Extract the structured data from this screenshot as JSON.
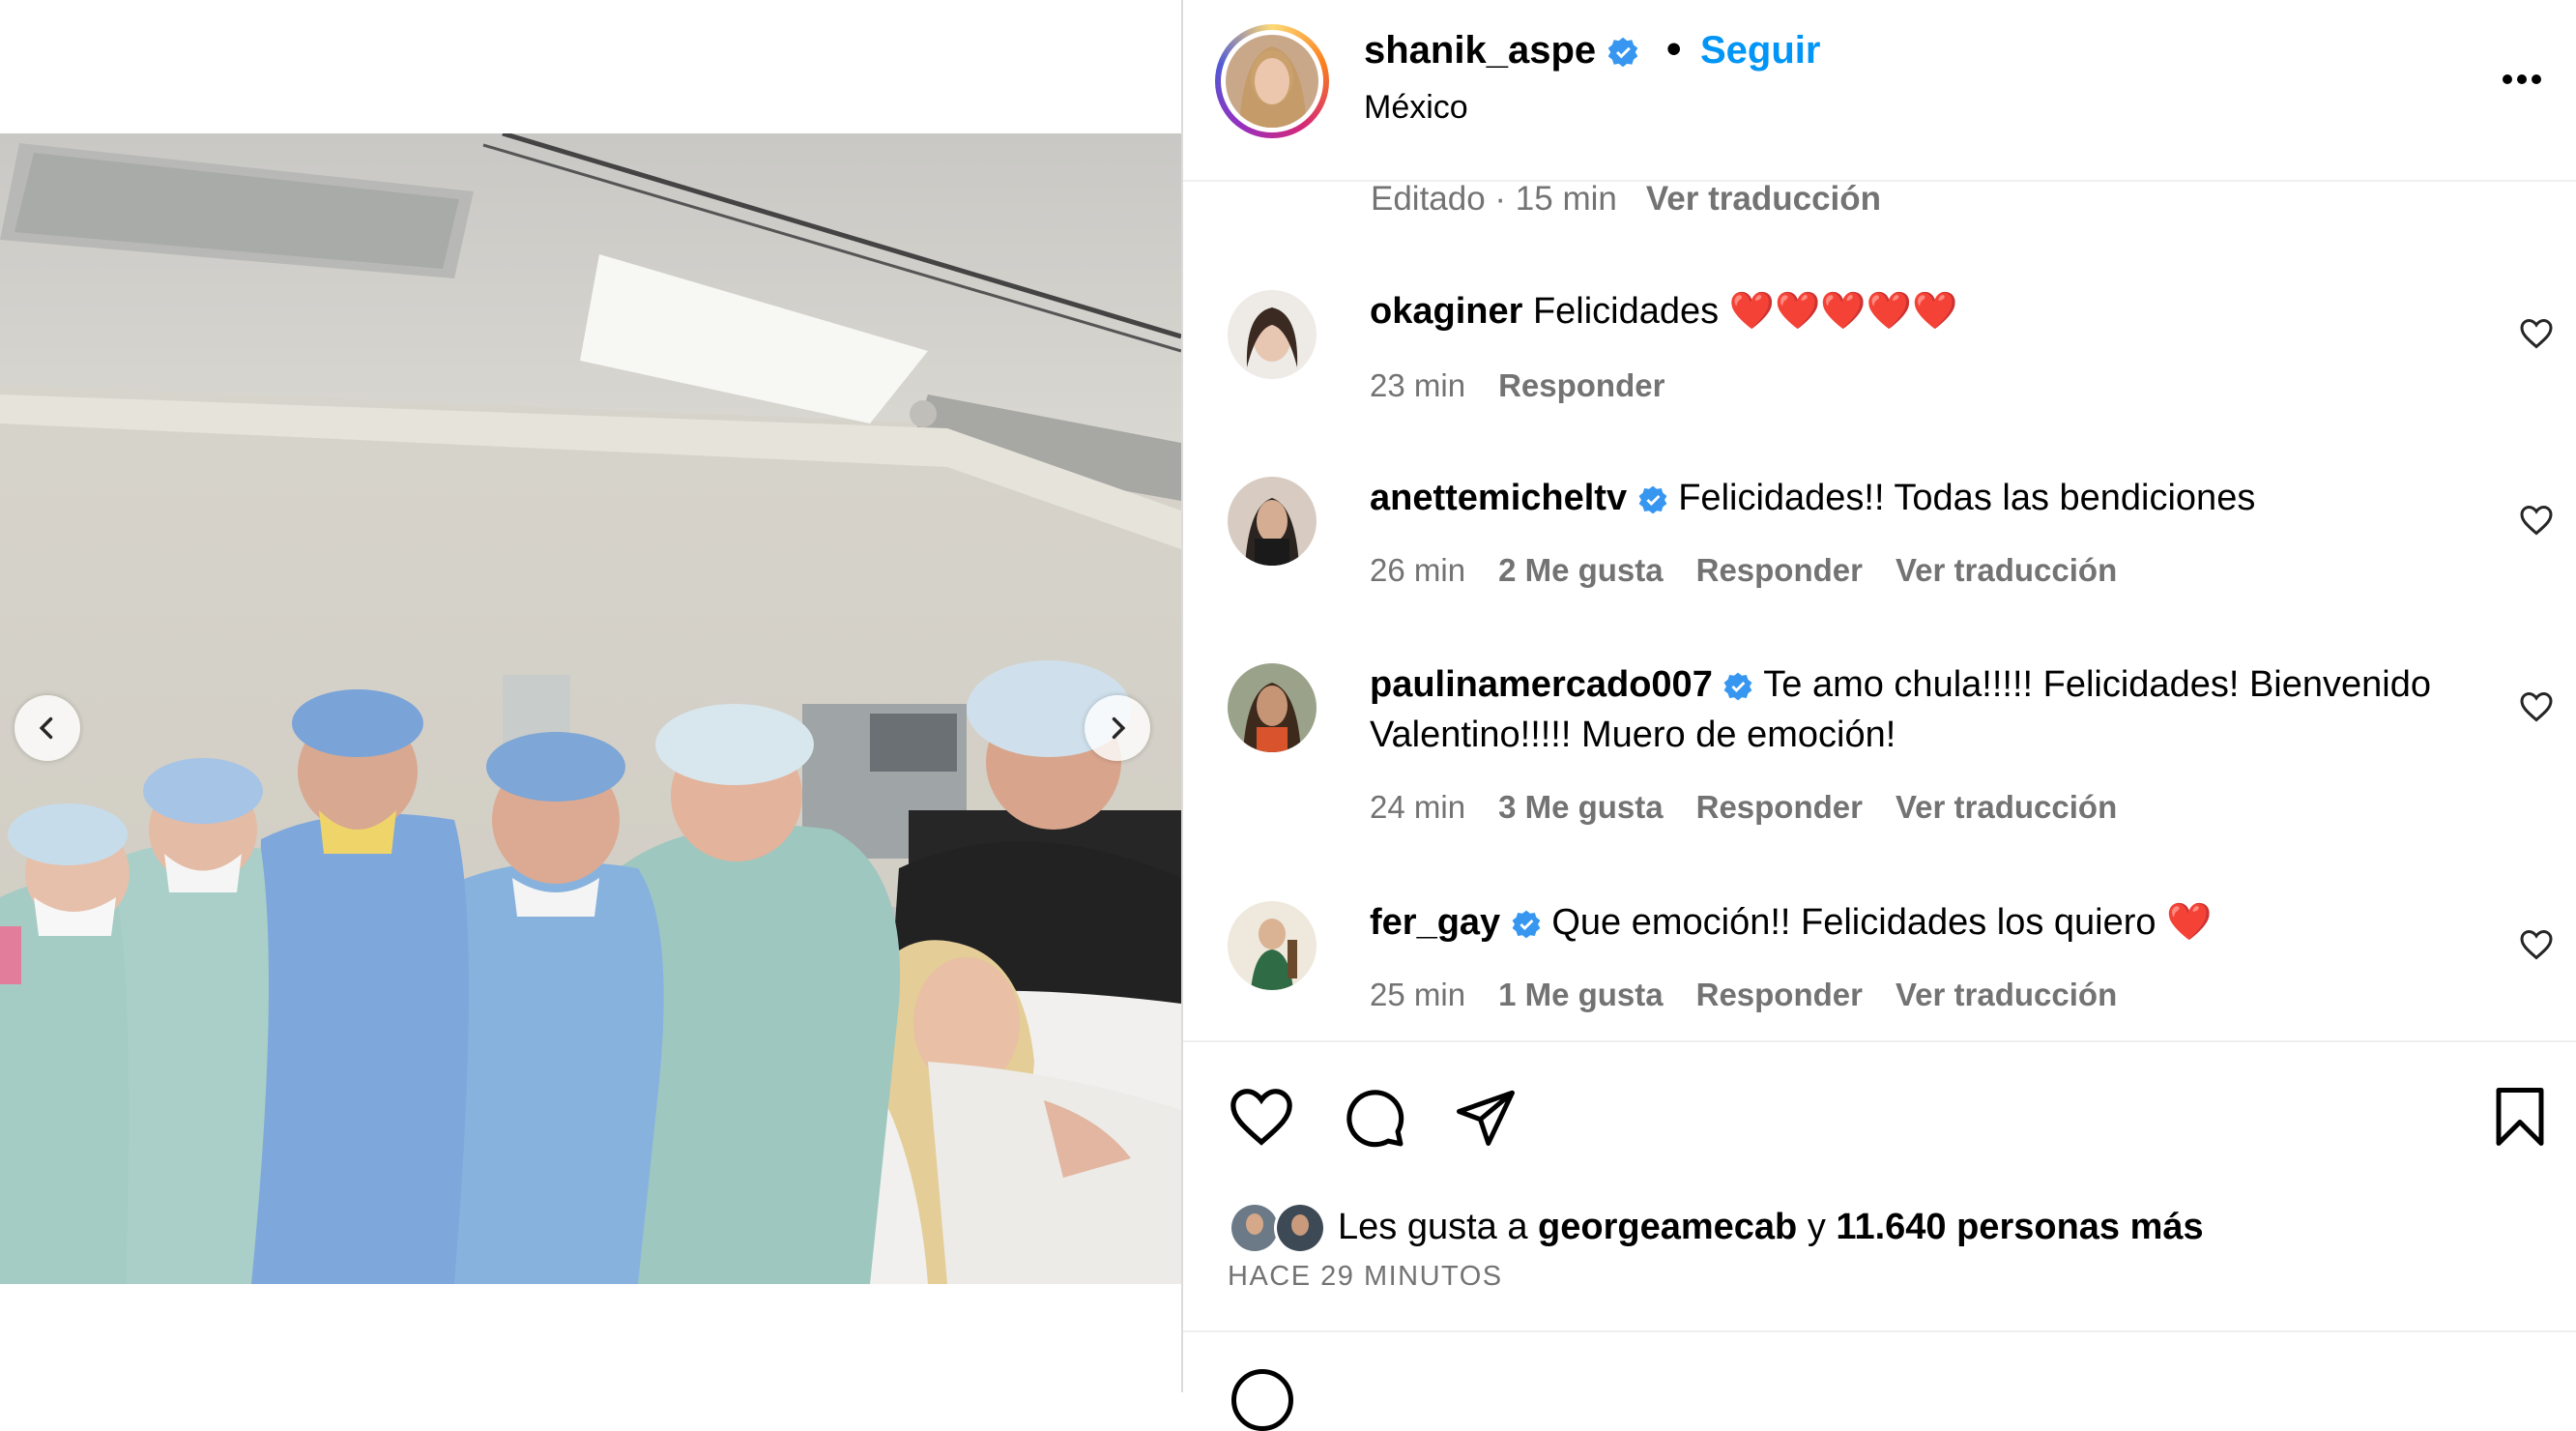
{
  "post": {
    "username": "shanik_aspe",
    "follow_label": "Seguir",
    "bullet": "•",
    "location": "México",
    "more_label": "•••",
    "edited_label": "Editado · 15 min",
    "translate_label": "Ver traducción"
  },
  "comments": [
    {
      "user": "okaginer",
      "verified": false,
      "text": "Felicidades ❤️❤️❤️❤️❤️",
      "time": "23 min",
      "likes": "",
      "reply": "Responder",
      "translate": ""
    },
    {
      "user": "anettemicheltv",
      "verified": true,
      "text": "Felicidades!! Todas las bendiciones",
      "time": "26 min",
      "likes": "2 Me gusta",
      "reply": "Responder",
      "translate": "Ver traducción"
    },
    {
      "user": "paulinamercado007",
      "verified": true,
      "text": "Te amo chula!!!!! Felicidades! Bienvenido Valentino!!!!! Muero de emoción!",
      "time": "24 min",
      "likes": "3 Me gusta",
      "reply": "Responder",
      "translate": "Ver traducción"
    },
    {
      "user": "fer_gay",
      "verified": true,
      "text": "Que emoción!! Felicidades los quiero ❤️",
      "time": "25 min",
      "likes": "1 Me gusta",
      "reply": "Responder",
      "translate": "Ver traducción"
    }
  ],
  "likes": {
    "prefix": "Les gusta a",
    "user": "georgeamecab",
    "connector": "y",
    "others": "11.640 personas más"
  },
  "timestamp": "HACE 29 MINUTOS",
  "colors": {
    "accent": "#0095f6",
    "verified": "#3797f0",
    "muted": "#737373"
  },
  "icons": [
    "like-icon",
    "comment-icon",
    "share-icon",
    "save-icon",
    "more-icon",
    "verified-icon",
    "chevron-left-icon",
    "chevron-right-icon"
  ]
}
